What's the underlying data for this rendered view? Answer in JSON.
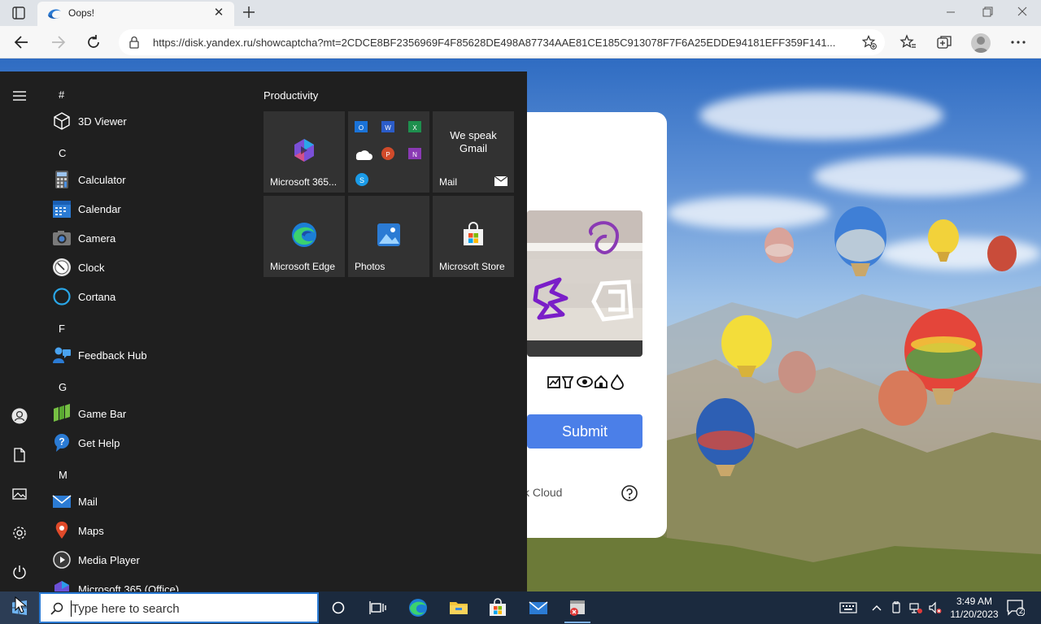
{
  "browser": {
    "tab_title": "Oops!",
    "url": "https://disk.yandex.ru/showcaptcha?mt=2CDCE8BF2356969F4F85628DE498A87734AAE81CE185C913078F7F6A25EDDE94181EFF359F141..."
  },
  "page": {
    "submit_label": "Submit",
    "footer_text": "k Cloud"
  },
  "start_menu": {
    "letters": [
      "#",
      "C",
      "F",
      "G",
      "M"
    ],
    "apps": [
      {
        "name": "3D Viewer"
      },
      {
        "name": "Calculator"
      },
      {
        "name": "Calendar"
      },
      {
        "name": "Camera"
      },
      {
        "name": "Clock"
      },
      {
        "name": "Cortana"
      },
      {
        "name": "Feedback Hub"
      },
      {
        "name": "Game Bar"
      },
      {
        "name": "Get Help"
      },
      {
        "name": "Mail"
      },
      {
        "name": "Maps"
      },
      {
        "name": "Media Player"
      },
      {
        "name": "Microsoft 365 (Office)"
      }
    ],
    "group_title": "Productivity",
    "tiles": [
      {
        "label": "Microsoft 365..."
      },
      {
        "label": ""
      },
      {
        "label": "Mail",
        "promo": "We speak Gmail"
      },
      {
        "label": "Microsoft Edge"
      },
      {
        "label": "Photos"
      },
      {
        "label": "Microsoft Store"
      }
    ]
  },
  "taskbar": {
    "search_placeholder": "Type here to search",
    "time": "3:49 AM",
    "date": "11/20/2023",
    "notification_count": "2"
  }
}
